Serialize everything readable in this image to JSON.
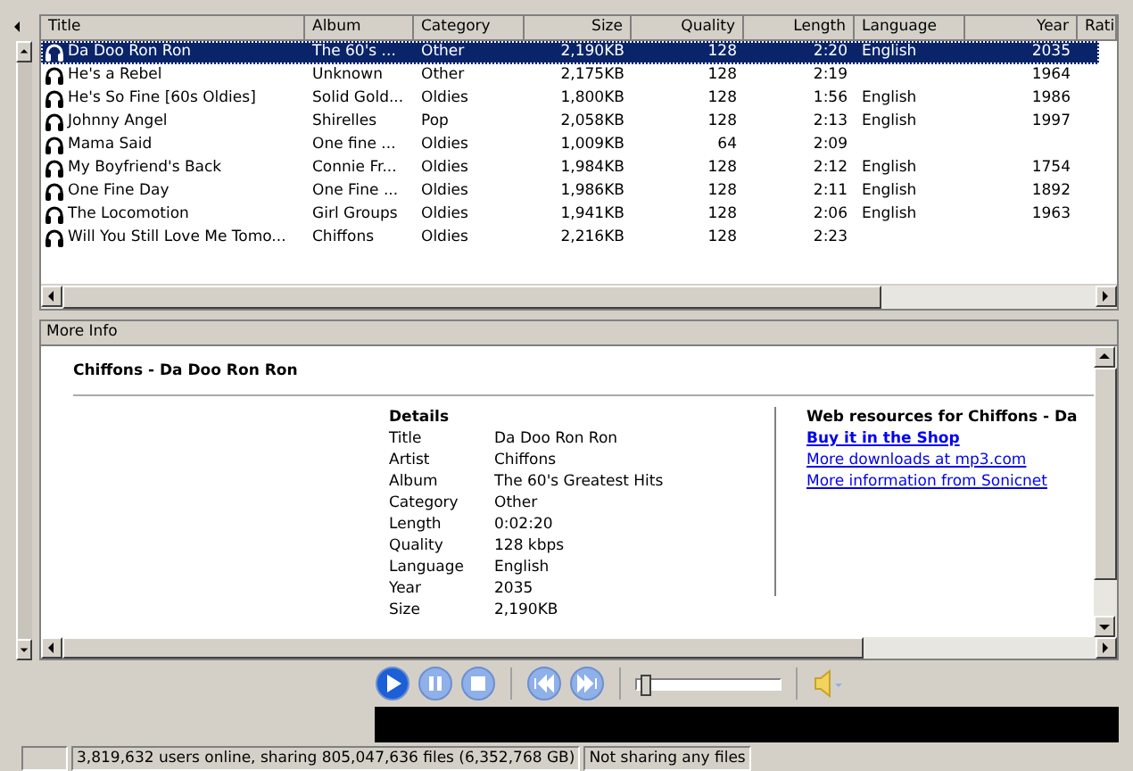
{
  "table": {
    "columns": [
      "Title",
      "Album",
      "Category",
      "Size",
      "Quality",
      "Length",
      "Language",
      "Year",
      "Rati"
    ],
    "rows": [
      {
        "selected": true,
        "cells": [
          "Da Doo Ron Ron",
          "The 60's ...",
          "Other",
          "2,190KB",
          "128",
          "2:20",
          "English",
          "2035"
        ]
      },
      {
        "selected": false,
        "cells": [
          "He's a Rebel",
          "Unknown",
          "Other",
          "2,175KB",
          "128",
          "2:19",
          "",
          "1964"
        ]
      },
      {
        "selected": false,
        "cells": [
          "He's So Fine [60s Oldies]",
          "Solid Gold...",
          "Oldies",
          "1,800KB",
          "128",
          "1:56",
          "English",
          "1986"
        ]
      },
      {
        "selected": false,
        "cells": [
          "Johnny Angel",
          "Shirelles",
          "Pop",
          "2,058KB",
          "128",
          "2:13",
          "English",
          "1997"
        ]
      },
      {
        "selected": false,
        "cells": [
          "Mama Said",
          "One fine ...",
          "Oldies",
          "1,009KB",
          "64",
          "2:09",
          "",
          ""
        ]
      },
      {
        "selected": false,
        "cells": [
          "My Boyfriend's Back",
          "Connie Fr...",
          "Oldies",
          "1,984KB",
          "128",
          "2:12",
          "English",
          "1754"
        ]
      },
      {
        "selected": false,
        "cells": [
          "One Fine Day",
          "One Fine ...",
          "Oldies",
          "1,986KB",
          "128",
          "2:11",
          "English",
          "1892"
        ]
      },
      {
        "selected": false,
        "cells": [
          "The Locomotion",
          "Girl Groups",
          "Oldies",
          "1,941KB",
          "128",
          "2:06",
          "English",
          "1963"
        ]
      },
      {
        "selected": false,
        "cells": [
          "Will You Still Love Me Tomo...",
          "Chiffons",
          "Oldies",
          "2,216KB",
          "128",
          "2:23",
          "",
          ""
        ]
      }
    ]
  },
  "more_info": {
    "header": "More Info",
    "heading": "Chiffons - Da Doo Ron Ron",
    "details_title": "Details",
    "details": [
      [
        "Title",
        "Da Doo Ron Ron"
      ],
      [
        "Artist",
        "Chiffons"
      ],
      [
        "Album",
        "The 60's Greatest Hits"
      ],
      [
        "Category",
        "Other"
      ],
      [
        "Length",
        "0:02:20"
      ],
      [
        "Quality",
        "128 kbps"
      ],
      [
        "Language",
        "English"
      ],
      [
        "Year",
        "2035"
      ],
      [
        "Size",
        "2,190KB"
      ]
    ],
    "web_title": "Web resources for Chiffons - Da",
    "links": [
      {
        "label": "Buy it in the Shop",
        "bold": true
      },
      {
        "label": "More downloads at mp3.com",
        "bold": false
      },
      {
        "label": "More information from Sonicnet",
        "bold": false
      }
    ]
  },
  "player": {
    "level": 0.02
  },
  "status_bar": [
    "3,819,632 users online, sharing 805,047,636 files (6,352,768 GB)",
    "Not sharing any files"
  ]
}
